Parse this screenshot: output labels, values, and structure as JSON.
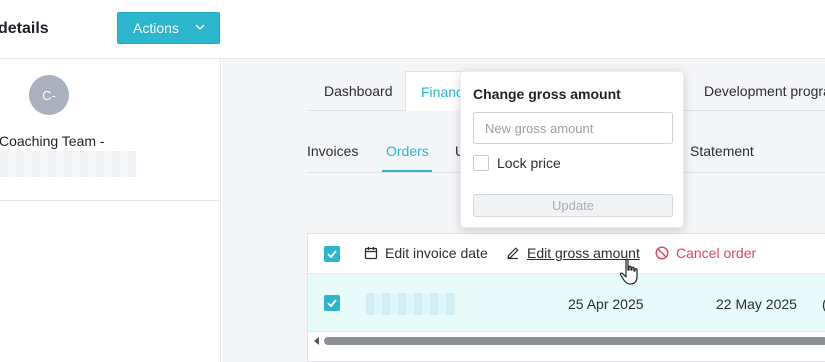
{
  "header": {
    "title": "details",
    "actions_label": "Actions"
  },
  "profile": {
    "avatar_initials": "C-",
    "team_name": "Coaching Team -"
  },
  "tabs": [
    {
      "label": "Dashboard"
    },
    {
      "label": "Financ"
    },
    {
      "label": "Development progra"
    }
  ],
  "subtabs": [
    {
      "label": "Invoices"
    },
    {
      "label": "Orders"
    },
    {
      "label": "U"
    },
    {
      "label": "Statement"
    }
  ],
  "toolbar": {
    "edit_invoice_date": "Edit invoice date",
    "edit_gross_amount": "Edit gross amount",
    "cancel_order": "Cancel order"
  },
  "row": {
    "date1": "25 Apr 2025",
    "date2": "22 May 2025"
  },
  "popover": {
    "title": "Change gross amount",
    "input_placeholder": "New gross amount",
    "lock_label": "Lock price",
    "update_label": "Update"
  },
  "colors": {
    "accent": "#2bb6cd",
    "danger": "#e0455e",
    "row_highlight": "#e8fbfb"
  }
}
